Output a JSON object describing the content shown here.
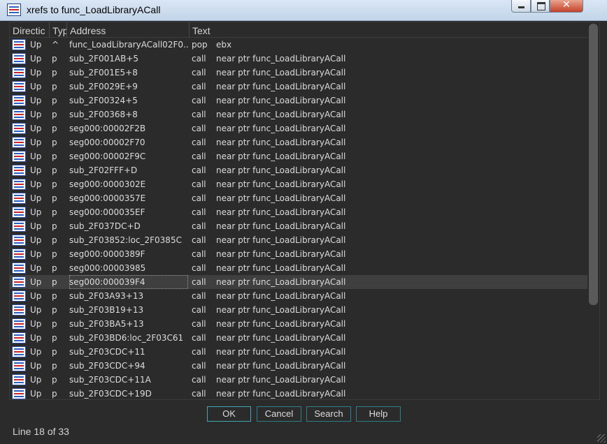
{
  "window": {
    "title": "xrefs to func_LoadLibraryACall"
  },
  "columns": [
    "Directic",
    "Typ",
    "Address",
    "Text"
  ],
  "rows": [
    {
      "dir": "Up",
      "type": "^",
      "addr": "func_LoadLibraryACall02F0...",
      "mn": "pop",
      "op": "ebx"
    },
    {
      "dir": "Up",
      "type": "p",
      "addr": "sub_2F001AB+5",
      "mn": "call",
      "op": "near ptr func_LoadLibraryACall"
    },
    {
      "dir": "Up",
      "type": "p",
      "addr": "sub_2F001E5+8",
      "mn": "call",
      "op": "near ptr func_LoadLibraryACall"
    },
    {
      "dir": "Up",
      "type": "p",
      "addr": "sub_2F0029E+9",
      "mn": "call",
      "op": "near ptr func_LoadLibraryACall"
    },
    {
      "dir": "Up",
      "type": "p",
      "addr": "sub_2F00324+5",
      "mn": "call",
      "op": "near ptr func_LoadLibraryACall"
    },
    {
      "dir": "Up",
      "type": "p",
      "addr": "sub_2F00368+8",
      "mn": "call",
      "op": "near ptr func_LoadLibraryACall"
    },
    {
      "dir": "Up",
      "type": "p",
      "addr": "seg000:00002F2B",
      "mn": "call",
      "op": "near ptr func_LoadLibraryACall"
    },
    {
      "dir": "Up",
      "type": "p",
      "addr": "seg000:00002F70",
      "mn": "call",
      "op": "near ptr func_LoadLibraryACall"
    },
    {
      "dir": "Up",
      "type": "p",
      "addr": "seg000:00002F9C",
      "mn": "call",
      "op": "near ptr func_LoadLibraryACall"
    },
    {
      "dir": "Up",
      "type": "p",
      "addr": "sub_2F02FFF+D",
      "mn": "call",
      "op": "near ptr func_LoadLibraryACall"
    },
    {
      "dir": "Up",
      "type": "p",
      "addr": "seg000:0000302E",
      "mn": "call",
      "op": "near ptr func_LoadLibraryACall"
    },
    {
      "dir": "Up",
      "type": "p",
      "addr": "seg000:0000357E",
      "mn": "call",
      "op": "near ptr func_LoadLibraryACall"
    },
    {
      "dir": "Up",
      "type": "p",
      "addr": "seg000:000035EF",
      "mn": "call",
      "op": "near ptr func_LoadLibraryACall"
    },
    {
      "dir": "Up",
      "type": "p",
      "addr": "sub_2F037DC+D",
      "mn": "call",
      "op": "near ptr func_LoadLibraryACall"
    },
    {
      "dir": "Up",
      "type": "p",
      "addr": "sub_2F03852:loc_2F0385C",
      "mn": "call",
      "op": "near ptr func_LoadLibraryACall"
    },
    {
      "dir": "Up",
      "type": "p",
      "addr": "seg000:0000389F",
      "mn": "call",
      "op": "near ptr func_LoadLibraryACall"
    },
    {
      "dir": "Up",
      "type": "p",
      "addr": "seg000:00003985",
      "mn": "call",
      "op": "near ptr func_LoadLibraryACall"
    },
    {
      "dir": "Up",
      "type": "p",
      "addr": "seg000:000039F4",
      "mn": "call",
      "op": "near ptr func_LoadLibraryACall",
      "selected": true
    },
    {
      "dir": "Up",
      "type": "p",
      "addr": "sub_2F03A93+13",
      "mn": "call",
      "op": "near ptr func_LoadLibraryACall"
    },
    {
      "dir": "Up",
      "type": "p",
      "addr": "sub_2F03B19+13",
      "mn": "call",
      "op": "near ptr func_LoadLibraryACall"
    },
    {
      "dir": "Up",
      "type": "p",
      "addr": "sub_2F03BA5+13",
      "mn": "call",
      "op": "near ptr func_LoadLibraryACall"
    },
    {
      "dir": "Up",
      "type": "p",
      "addr": "sub_2F03BD6:loc_2F03C61",
      "mn": "call",
      "op": "near ptr func_LoadLibraryACall"
    },
    {
      "dir": "Up",
      "type": "p",
      "addr": "sub_2F03CDC+11",
      "mn": "call",
      "op": "near ptr func_LoadLibraryACall"
    },
    {
      "dir": "Up",
      "type": "p",
      "addr": "sub_2F03CDC+94",
      "mn": "call",
      "op": "near ptr func_LoadLibraryACall"
    },
    {
      "dir": "Up",
      "type": "p",
      "addr": "sub_2F03CDC+11A",
      "mn": "call",
      "op": "near ptr func_LoadLibraryACall"
    },
    {
      "dir": "Up",
      "type": "p",
      "addr": "sub_2F03CDC+19D",
      "mn": "call",
      "op": "near ptr func_LoadLibraryACall"
    }
  ],
  "buttons": {
    "ok": "OK",
    "cancel": "Cancel",
    "search": "Search",
    "help": "Help"
  },
  "status": "Line 18 of 33",
  "icons": {
    "row": "xref-list-icon",
    "app": "ida-window-icon"
  },
  "colors": {
    "background": "#2b2b2b",
    "text": "#dcdcdc",
    "button_border": "#2f7d86",
    "selected_row": "#3f3f3f"
  }
}
